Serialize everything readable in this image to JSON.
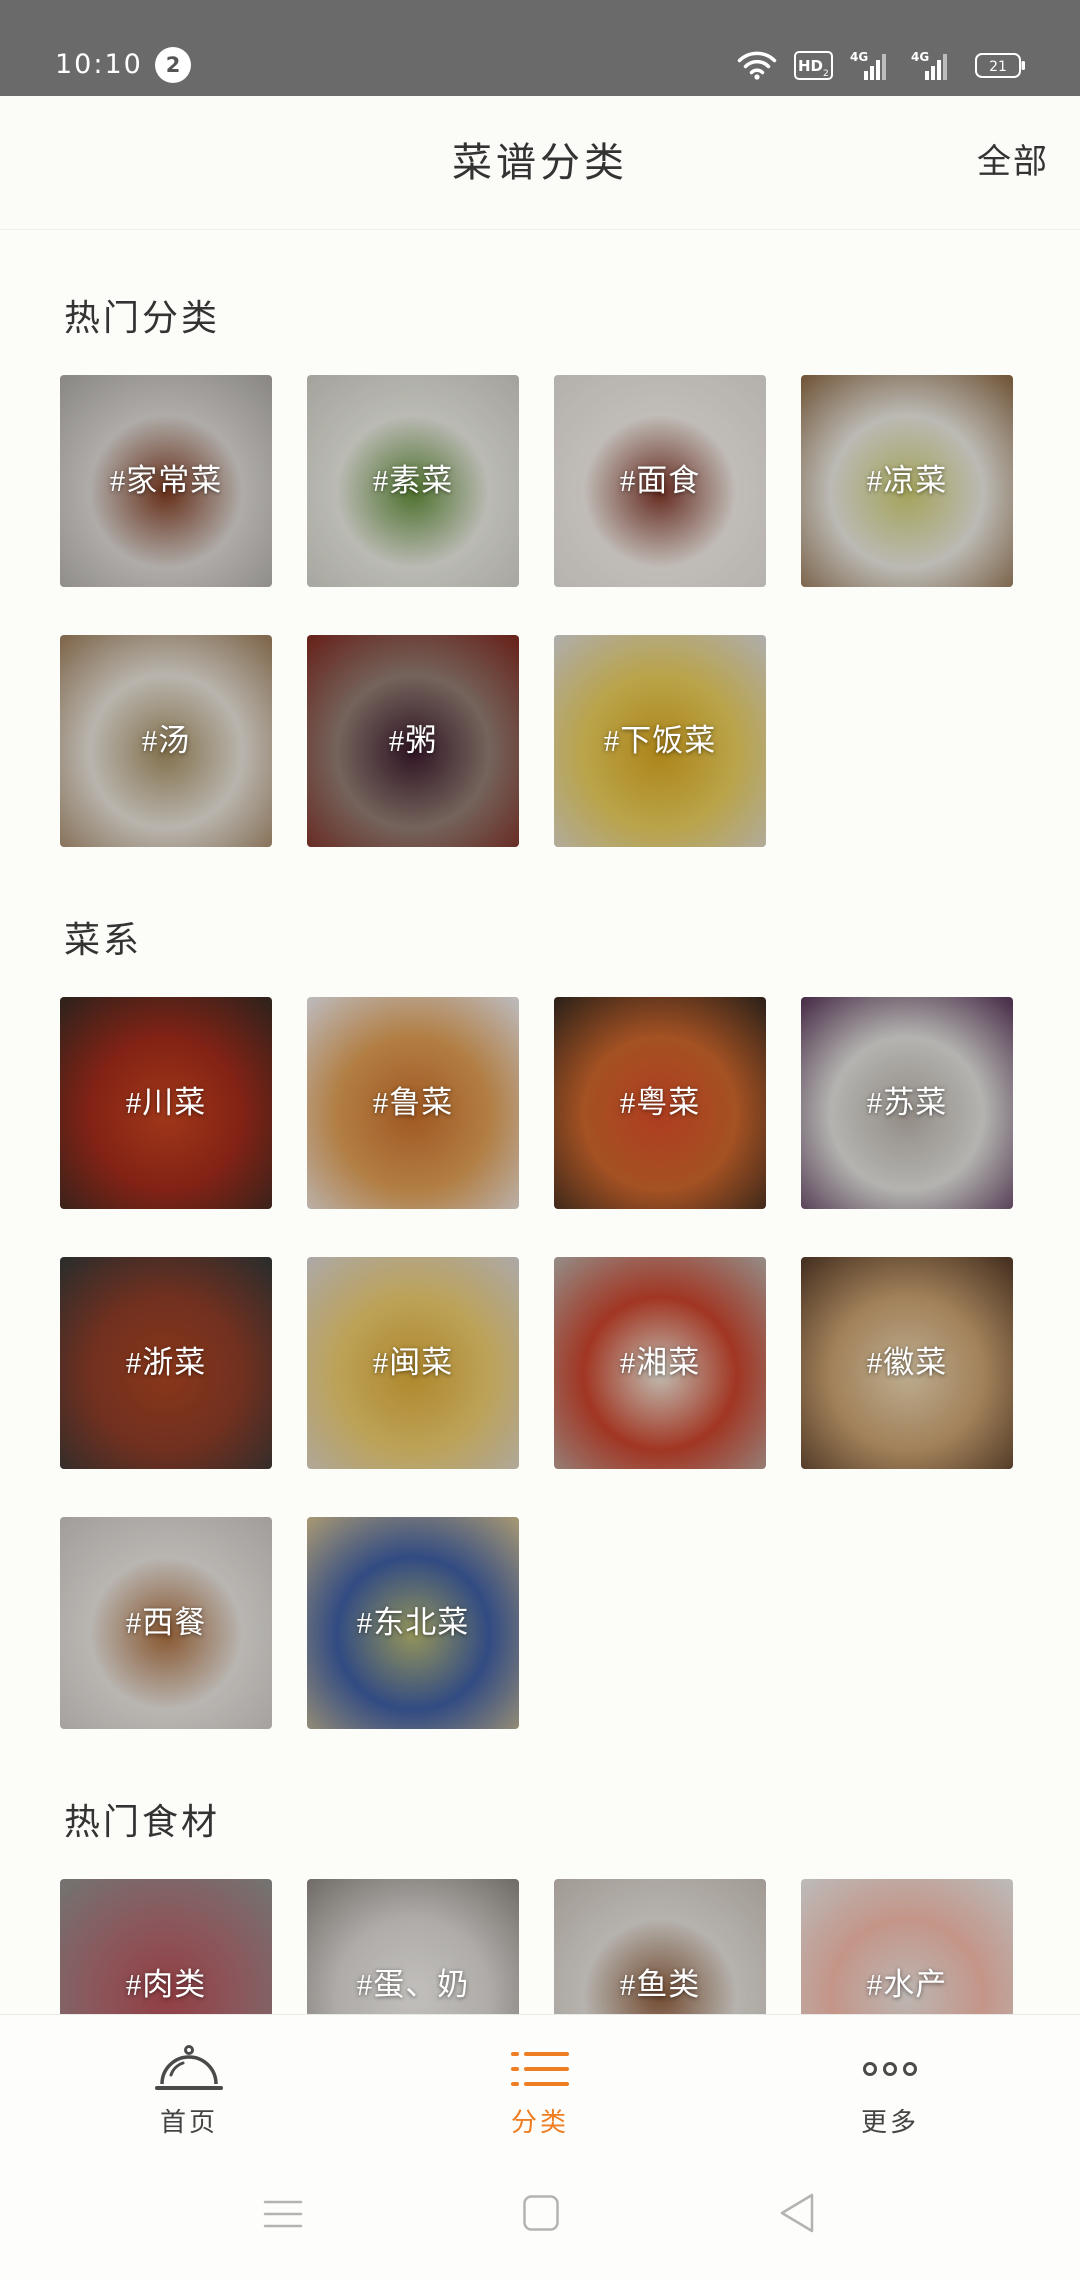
{
  "theme": {
    "accent": "#ef7d22",
    "status_bar_bg": "#6a6a6a",
    "page_bg": "#fcfcf9",
    "text": "#333333",
    "muted_icon": "#b3b3b3"
  },
  "status_bar": {
    "time": "10:10",
    "notification_count": "2",
    "hd_label": "HD",
    "hd_sim": "2",
    "network_1": "4G",
    "network_2": "4G",
    "battery": "21"
  },
  "header": {
    "title": "菜谱分类",
    "all_link": "全部"
  },
  "sections": [
    {
      "title": "热门分类",
      "items": [
        {
          "label": "#家常菜",
          "colors": [
            "#aaa7a4",
            "#d6d2ce",
            "#7d3a1f"
          ]
        },
        {
          "label": "#素菜",
          "colors": [
            "#c9c8c0",
            "#e4e4dc",
            "#5f8a38"
          ]
        },
        {
          "label": "#面食",
          "colors": [
            "#dcd8d3",
            "#ece6e0",
            "#7b3426"
          ]
        },
        {
          "label": "#凉菜",
          "colors": [
            "#8c6b49",
            "#e5e3dc",
            "#c8c86e"
          ]
        },
        {
          "label": "#汤",
          "colors": [
            "#9c7f5e",
            "#e2ddd4",
            "#a08a5e"
          ]
        },
        {
          "label": "#粥",
          "colors": [
            "#7e2c22",
            "#8e7a70",
            "#3b1a2c"
          ]
        },
        {
          "label": "#下饭菜",
          "colors": [
            "#d6d3cc",
            "#e3c85a",
            "#d3a21e"
          ]
        }
      ]
    },
    {
      "title": "菜系",
      "items": [
        {
          "label": "#川菜",
          "colors": [
            "#3b2a22",
            "#9f2a1a",
            "#c4441f"
          ]
        },
        {
          "label": "#鲁菜",
          "colors": [
            "#e6e1e1",
            "#d99a52",
            "#c46c2a"
          ]
        },
        {
          "label": "#粤菜",
          "colors": [
            "#3c2b1f",
            "#c9642b",
            "#d64a28"
          ]
        },
        {
          "label": "#苏菜",
          "colors": [
            "#5c3c5c",
            "#dcdbd7",
            "#b3aba3"
          ]
        },
        {
          "label": "#浙菜",
          "colors": [
            "#363735",
            "#8a3b27",
            "#a8431f"
          ]
        },
        {
          "label": "#闽菜",
          "colors": [
            "#d4cec8",
            "#e6c66c",
            "#d6a636"
          ]
        },
        {
          "label": "#湘菜",
          "colors": [
            "#b6a79f",
            "#c5422b",
            "#ebe6d8"
          ]
        },
        {
          "label": "#徽菜",
          "colors": [
            "#583d29",
            "#c69e6e",
            "#e6d2ae"
          ]
        },
        {
          "label": "#西餐",
          "colors": [
            "#c6c2be",
            "#e2ded9",
            "#a66a3a"
          ]
        },
        {
          "label": "#东北菜",
          "colors": [
            "#c6b68e",
            "#3d5ca0",
            "#b6b66e"
          ]
        }
      ]
    },
    {
      "title": "热门食材",
      "items": [
        {
          "label": "#肉类",
          "colors": [
            "#8e8c8a",
            "#a96c72",
            "#b24c52"
          ]
        },
        {
          "label": "#蛋、奶",
          "colors": [
            "#8c8680",
            "#d6d2ce",
            "#edeae6"
          ]
        },
        {
          "label": "#鱼类",
          "colors": [
            "#c6beb6",
            "#dedad4",
            "#8b5b3b"
          ]
        },
        {
          "label": "#水产",
          "colors": [
            "#e6e2e0",
            "#efb7a7",
            "#e6ded9"
          ]
        }
      ]
    }
  ],
  "bottom_nav": {
    "items": [
      {
        "label": "首页",
        "icon": "cloche-icon",
        "active": false
      },
      {
        "label": "分类",
        "icon": "list-icon",
        "active": true
      },
      {
        "label": "更多",
        "icon": "more-dots-icon",
        "active": false
      }
    ]
  },
  "system_nav": {
    "icons": [
      "menu-icon",
      "home-square-icon",
      "back-triangle-icon"
    ]
  }
}
